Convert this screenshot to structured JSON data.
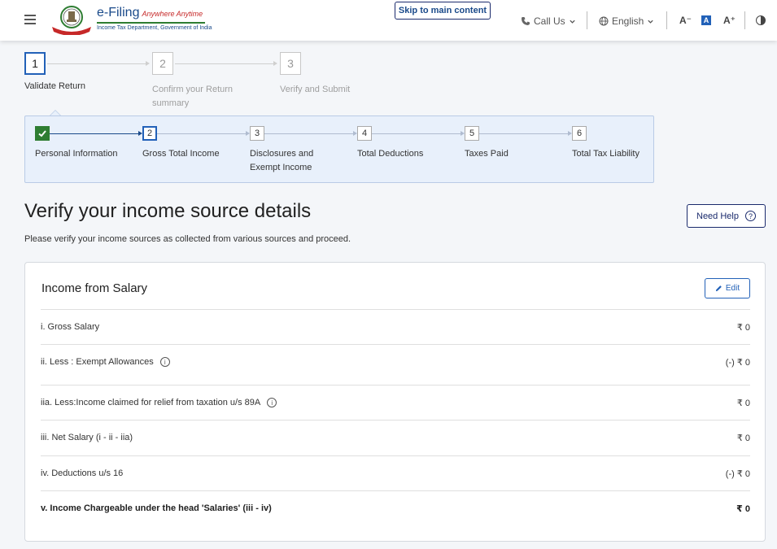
{
  "header": {
    "logo_title": "e-Filing",
    "logo_tagline": "Anywhere Anytime",
    "logo_subtitle": "Income Tax Department, Government of India",
    "skip_link": "Skip to main content",
    "call_us": "Call Us",
    "language": "English",
    "font_decrease": "A⁻",
    "font_reset": "A",
    "font_increase": "A⁺"
  },
  "main_steps": [
    {
      "number": "1",
      "label": "Validate Return",
      "state": "active"
    },
    {
      "number": "2",
      "label": "Confirm your Return summary",
      "state": "pending"
    },
    {
      "number": "3",
      "label": "Verify and Submit",
      "state": "pending"
    }
  ],
  "sub_steps": [
    {
      "number": "✓",
      "label": "Personal Information",
      "state": "done"
    },
    {
      "number": "2",
      "label": "Gross Total Income",
      "state": "current"
    },
    {
      "number": "3",
      "label": "Disclosures and Exempt Income",
      "state": "pending"
    },
    {
      "number": "4",
      "label": "Total Deductions",
      "state": "pending"
    },
    {
      "number": "5",
      "label": "Taxes Paid",
      "state": "pending"
    },
    {
      "number": "6",
      "label": "Total Tax Liability",
      "state": "pending"
    }
  ],
  "page": {
    "title": "Verify your income source details",
    "description": "Please verify your income sources as collected from various sources and proceed.",
    "need_help": "Need Help"
  },
  "salary_card": {
    "title": "Income from Salary",
    "edit_label": "Edit",
    "rows": [
      {
        "label": "i. Gross Salary",
        "value": "₹ 0",
        "info": false
      },
      {
        "label": "ii. Less : Exempt Allowances",
        "value": "(-) ₹ 0",
        "info": true
      },
      {
        "label": "iia. Less:Income claimed for relief from taxation u/s 89A",
        "value": "₹ 0",
        "info": true
      },
      {
        "label": "iii. Net Salary (i - ii - iia)",
        "value": "₹ 0",
        "info": false
      },
      {
        "label": "iv. Deductions u/s 16",
        "value": "(-) ₹ 0",
        "info": false
      },
      {
        "label": "v. Income Chargeable under the head 'Salaries' (iii - iv)",
        "value": "₹ 0",
        "info": false
      }
    ]
  },
  "colors": {
    "primary": "#2261b8",
    "navy": "#1a2a6c",
    "success": "#2e7d32",
    "panel": "#e8f0fb"
  }
}
